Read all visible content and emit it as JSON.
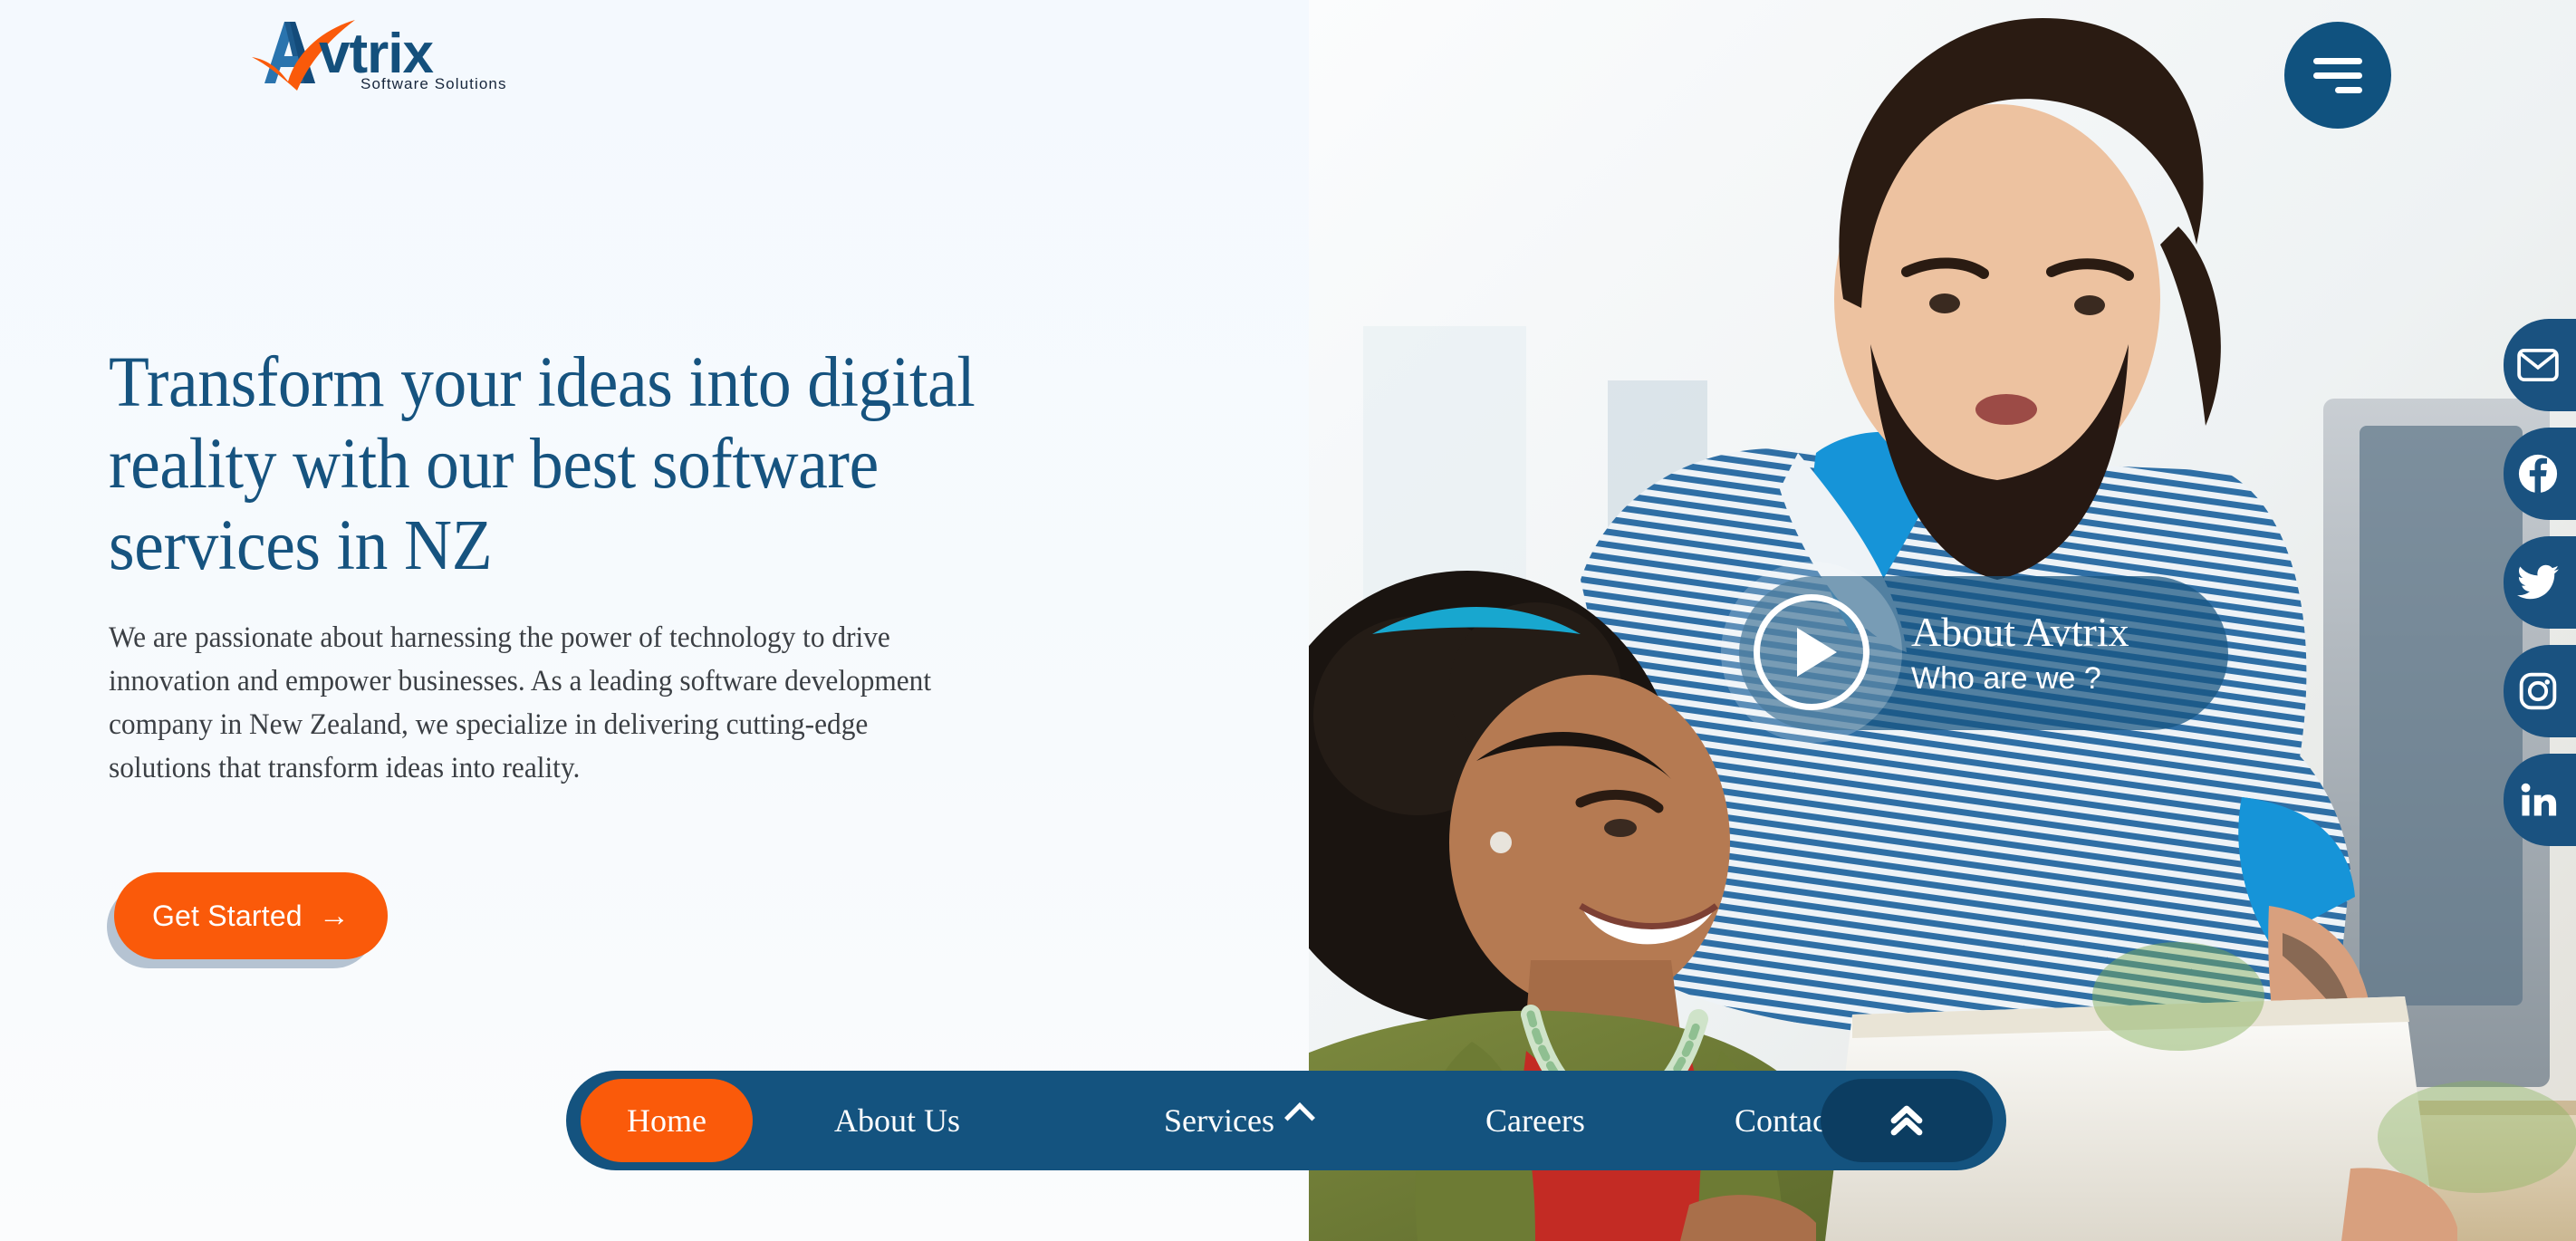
{
  "brand": {
    "name": "Avtrix",
    "tagline": "Software Solutions",
    "mark_icon": "avtrix-a-checkmark-logo",
    "colors": {
      "primary_blue": "#14537f",
      "dark_blue": "#0c3d61",
      "accent_orange": "#FA5A0A",
      "page_bg": "#f5f9fd",
      "heading_blue": "#16537f",
      "body_text": "#3b3f44",
      "cta_shadow": "#b5c3d2"
    }
  },
  "header": {
    "menu_button": {
      "icon": "hamburger-menu-icon",
      "label": "Menu"
    }
  },
  "hero": {
    "headline": "Transform your ideas into digital reality with our best software services in NZ",
    "paragraph": "We are passionate about harnessing the power of technology to drive innovation and empower businesses. As a leading software development company in New Zealand, we specialize in delivering cutting-edge solutions that transform ideas into reality.",
    "cta": {
      "label": "Get Started",
      "arrow_icon": "arrow-right-icon",
      "arrow_glyph": "→"
    }
  },
  "video_overlay": {
    "title": "About Avtrix",
    "subtitle": "Who are we ?",
    "play_icon": "play-button-icon"
  },
  "social_rail": [
    {
      "name": "email",
      "icon": "envelope-icon",
      "label": "Email"
    },
    {
      "name": "facebook",
      "icon": "facebook-icon",
      "label": "Facebook"
    },
    {
      "name": "twitter",
      "icon": "twitter-icon",
      "label": "Twitter"
    },
    {
      "name": "instagram",
      "icon": "instagram-icon",
      "label": "Instagram"
    },
    {
      "name": "linkedin",
      "icon": "linkedin-icon",
      "label": "LinkedIn"
    }
  ],
  "navbar": {
    "items": [
      {
        "label": "Home",
        "active": true,
        "icon": null
      },
      {
        "label": "About Us",
        "active": false,
        "icon": null
      },
      {
        "label": "Services",
        "active": false,
        "icon": "chevron-up-icon"
      },
      {
        "label": "Careers",
        "active": false,
        "icon": null
      },
      {
        "label": "Contact Us",
        "active": false,
        "icon": null
      }
    ],
    "scroll_top": {
      "icon": "double-chevron-up-icon",
      "label": "Back to top"
    }
  },
  "photo": {
    "alt": "Bearded man in blue striped shirt leaning over smiling woman with afro wearing green jacket and red top, both looking at a laptop in a bright office"
  }
}
